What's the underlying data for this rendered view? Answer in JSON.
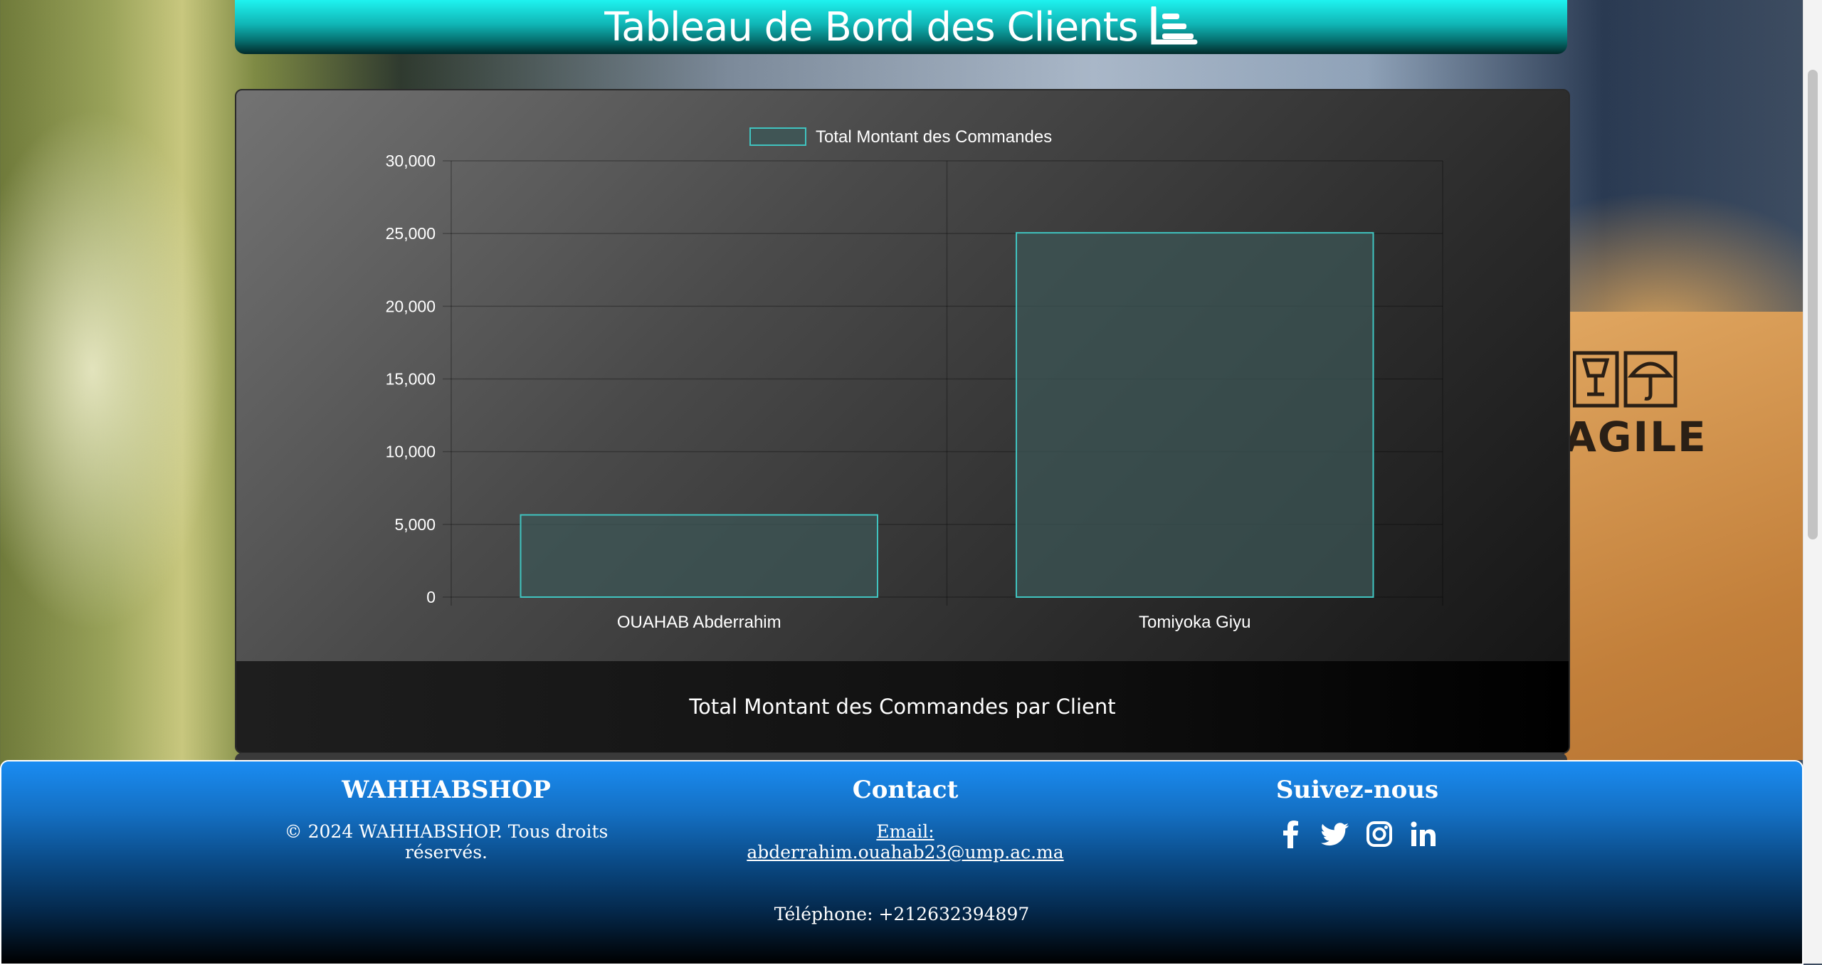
{
  "header": {
    "title": "Tableau de Bord des Clients",
    "icon": "chart-bar-icon"
  },
  "chart_card": {
    "caption": "Total Montant des Commandes par Client"
  },
  "chart_data": {
    "type": "bar",
    "categories": [
      "OUAHAB Abderrahim",
      "Tomiyoka Giyu"
    ],
    "series": [
      {
        "name": "Total Montant des Commandes",
        "values": [
          5650,
          25050
        ]
      }
    ],
    "ylim": [
      0,
      30000
    ],
    "yticks": [
      "0",
      "5,000",
      "10,000",
      "15,000",
      "20,000",
      "25,000",
      "30,000"
    ],
    "ytick_values": [
      0,
      5000,
      10000,
      15000,
      20000,
      25000,
      30000
    ],
    "legend_position": "top-center",
    "grid": true,
    "bar_fill": "#3c5656",
    "bar_stroke": "#40c4c0"
  },
  "background": {
    "box_text": "AGILE"
  },
  "footer": {
    "brand": {
      "title": "WAHHABSHOP",
      "copyright": "© 2024 WAHHABSHOP. Tous droits réservés."
    },
    "contact": {
      "title": "Contact",
      "email": "Email: abderrahim.ouahab23@ump.ac.ma",
      "phone": "Téléphone: +212632394897"
    },
    "social": {
      "title": "Suivez-nous",
      "icons": [
        "facebook-icon",
        "twitter-icon",
        "instagram-icon",
        "linkedin-icon"
      ]
    }
  }
}
